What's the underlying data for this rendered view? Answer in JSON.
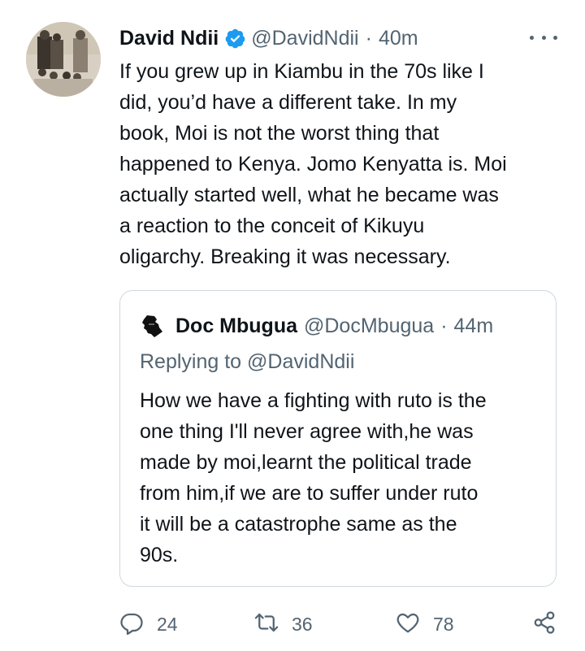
{
  "tweet": {
    "author_name": "David Ndii",
    "author_handle": "@DavidNdii",
    "separator": "·",
    "time": "40m",
    "text_lines": [
      "If you grew up in Kiambu in the 70s like I",
      "did, you’d have a different take. In my",
      "book, Moi is not the worst thing that",
      "happened to Kenya. Jomo Kenyatta is. Moi",
      "actually started well, what he became was",
      "a reaction to the conceit of Kikuyu",
      "oligarchy. Breaking it was necessary."
    ]
  },
  "quoted_tweet": {
    "author_name": "Doc Mbugua",
    "author_handle": "@DocMbugua",
    "separator": "·",
    "time": "44m",
    "replying_to": "Replying to @DavidNdii",
    "text_lines": [
      "How  we have a fighting with ruto is the",
      "one thing I'll never agree with,he was",
      "made by moi,learnt the political trade",
      "from him,if we are to suffer under ruto",
      "it will be a catastrophe same as the",
      "90s."
    ]
  },
  "actions": {
    "replies": "24",
    "retweets": "36",
    "likes": "78"
  },
  "colors": {
    "text": "#0f1419",
    "secondary": "#536471",
    "verified": "#1d9bf0",
    "border": "#cfd9de"
  },
  "icons": [
    "verified-badge-icon",
    "more-icon",
    "reply-icon",
    "retweet-icon",
    "like-icon",
    "share-icon"
  ]
}
